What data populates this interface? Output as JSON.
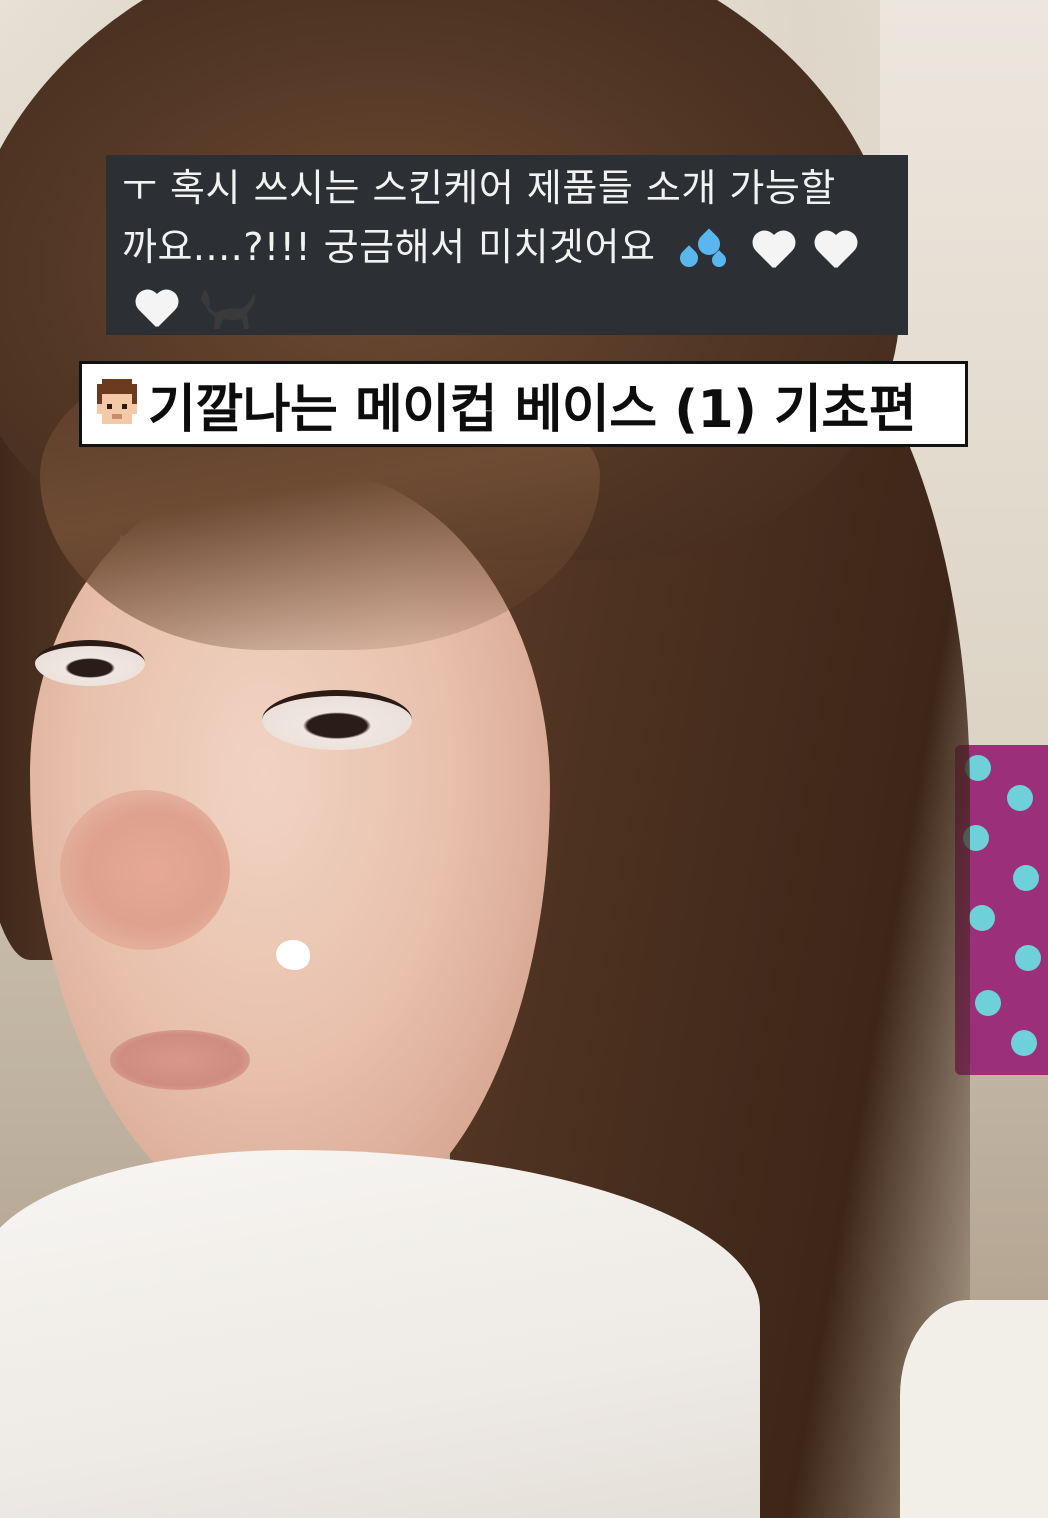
{
  "comment": {
    "line1": "ㅜ 혹시 쓰시는 스킨케어 제품들 소개 가능할",
    "line2_text": "까요....?!!! 궁금해서 미치겟어요",
    "emojis": [
      "sweat-droplets-icon",
      "white-heart-icon",
      "white-heart-icon",
      "white-heart-icon",
      "black-cat-icon"
    ],
    "colors": {
      "background": "#2c3035",
      "text": "#f2f2f2",
      "droplets": "#59b6ef",
      "heart": "#f4f4f4"
    }
  },
  "caption": {
    "icon": "man-face-icon",
    "text": "기깔나는 메이컵 베이스 (1) 기초편",
    "colors": {
      "background": "#ffffff",
      "border": "#111111",
      "text": "#0d0d0d"
    }
  },
  "photo": {
    "cream_dot_color": "#ffffff"
  }
}
